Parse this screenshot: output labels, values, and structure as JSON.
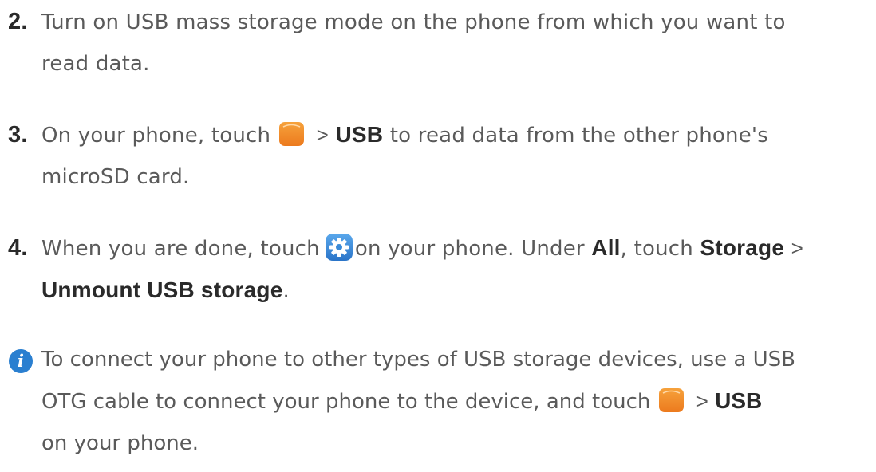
{
  "steps": [
    {
      "number": "2.",
      "line1": "Turn on USB mass storage mode on the phone from which you want to",
      "line2": "read data."
    },
    {
      "number": "3.",
      "prefix": "On your phone, touch",
      "separator": ">",
      "bold": "USB",
      "suffix": "to read data from the other phone's",
      "line2": "microSD card.",
      "icon": "files-icon"
    },
    {
      "number": "4.",
      "prefix": "When you are done, touch",
      "middle": "on your phone. Under",
      "bold1": "All",
      "comma_touch": ", touch",
      "bold2": "Storage",
      "separator": ">",
      "line2_bold": "Unmount USB storage",
      "line2_end": ".",
      "icon": "settings-icon"
    }
  ],
  "note": {
    "icon": "info-icon",
    "line1": "To connect your phone to other types of USB storage devices, use a USB",
    "line2_prefix": "OTG cable to connect your phone to the device, and touch",
    "separator": ">",
    "bold": "USB",
    "line3": "on your phone."
  },
  "colors": {
    "text": "#5a5a5a",
    "bold_text": "#2a2a2a",
    "files_icon": "#f08a2a",
    "settings_icon": "#3a8ad8",
    "info_icon": "#2a7fd0"
  }
}
